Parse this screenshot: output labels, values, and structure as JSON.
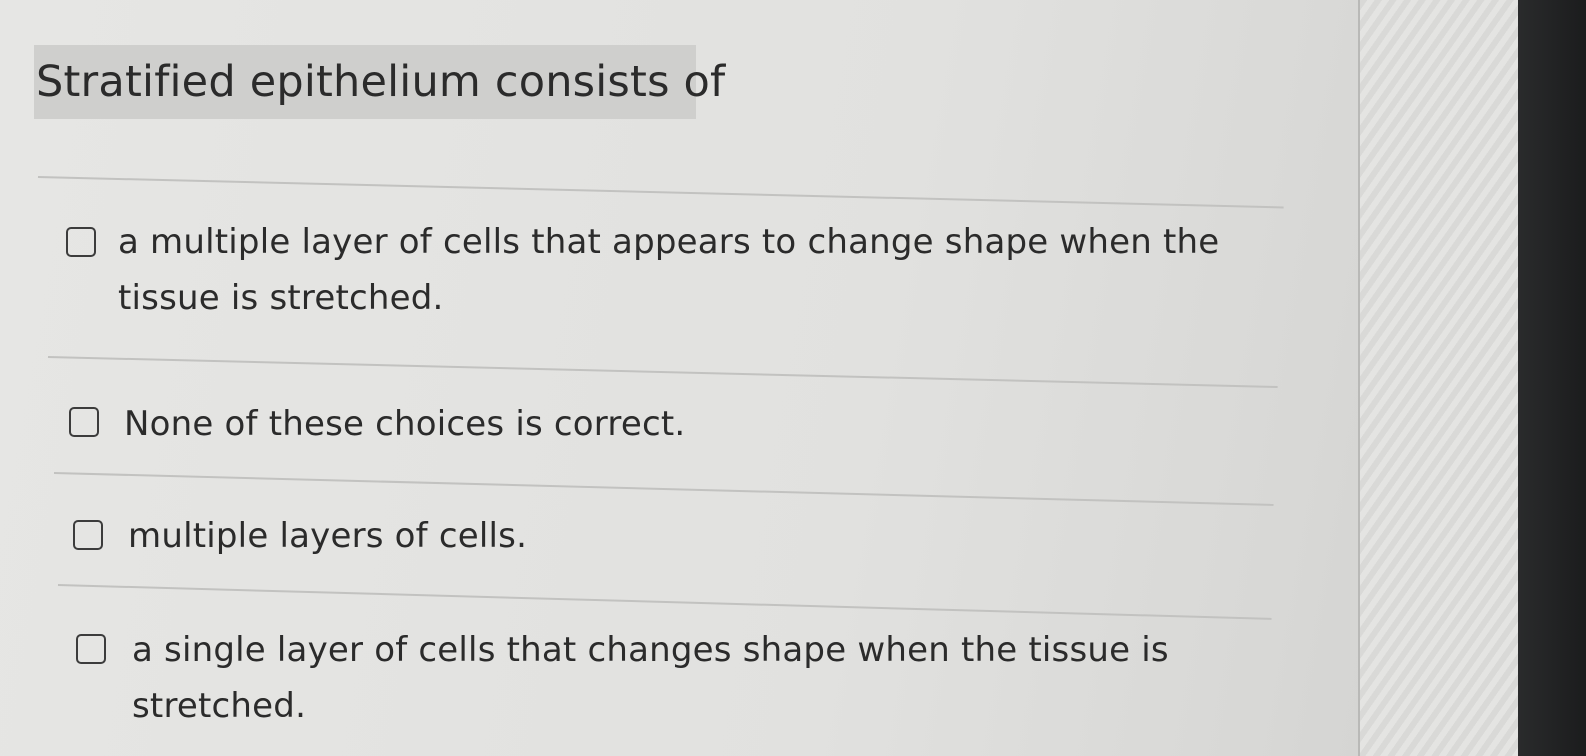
{
  "question": {
    "title": "Stratified epithelium consists of"
  },
  "options": [
    {
      "label": "a multiple layer of cells that appears to change shape when the tissue is stretched.",
      "checked": false
    },
    {
      "label": "None of these choices is correct.",
      "checked": false
    },
    {
      "label": "multiple layers of cells.",
      "checked": false
    },
    {
      "label": "a single layer of cells that changes shape when the tissue is stretched.",
      "checked": false
    }
  ]
}
